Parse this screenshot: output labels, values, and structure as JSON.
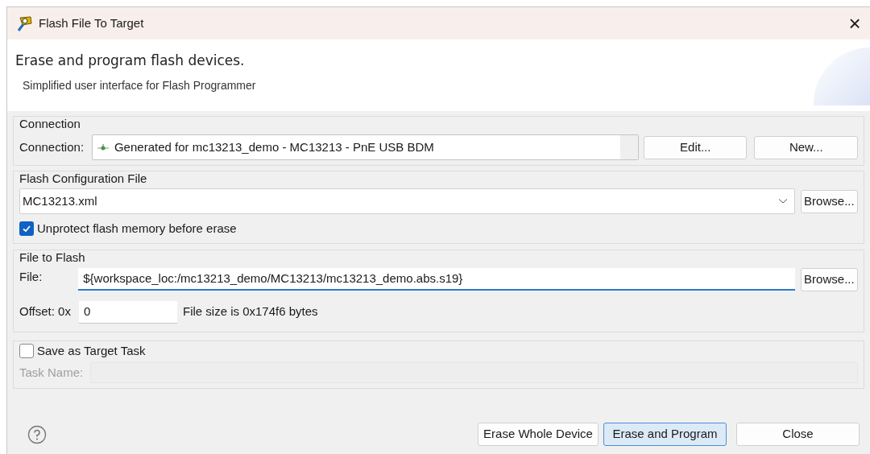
{
  "window": {
    "title": "Flash File To Target",
    "close": "×"
  },
  "header": {
    "title": "Erase and program flash devices.",
    "subtitle": "Simplified user interface for Flash Programmer"
  },
  "connection_group": {
    "legend": "Connection",
    "label": "Connection:",
    "value": "Generated for mc13213_demo - MC13213 - PnE USB BDM",
    "buttons": [
      "Edit...",
      "New..."
    ]
  },
  "flash_config_group": {
    "legend": "Flash Configuration File",
    "value": "MC13213.xml",
    "button": "Browse...",
    "checkbox": {
      "label": "Unprotect flash memory before erase",
      "checked": true
    }
  },
  "file_group": {
    "legend": "File to Flash",
    "file_label": "File:",
    "file_value": "${workspace_loc:/mc13213_demo/MC13213/mc13213_demo.abs.s19}",
    "file_focused": true,
    "button": "Browse...",
    "offset_label": "Offset: 0x",
    "offset_value": "0",
    "size_text": "File size is 0x174f6 bytes"
  },
  "task_group": {
    "checkbox": {
      "label": "Save as Target Task",
      "checked": false
    },
    "task_label": "Task Name:",
    "disabled": true
  },
  "footer_buttons": [
    {
      "label": "Erase Whole Device",
      "default": false
    },
    {
      "label": "Erase and Program",
      "default": true
    },
    {
      "label": "Close",
      "default": false
    }
  ]
}
